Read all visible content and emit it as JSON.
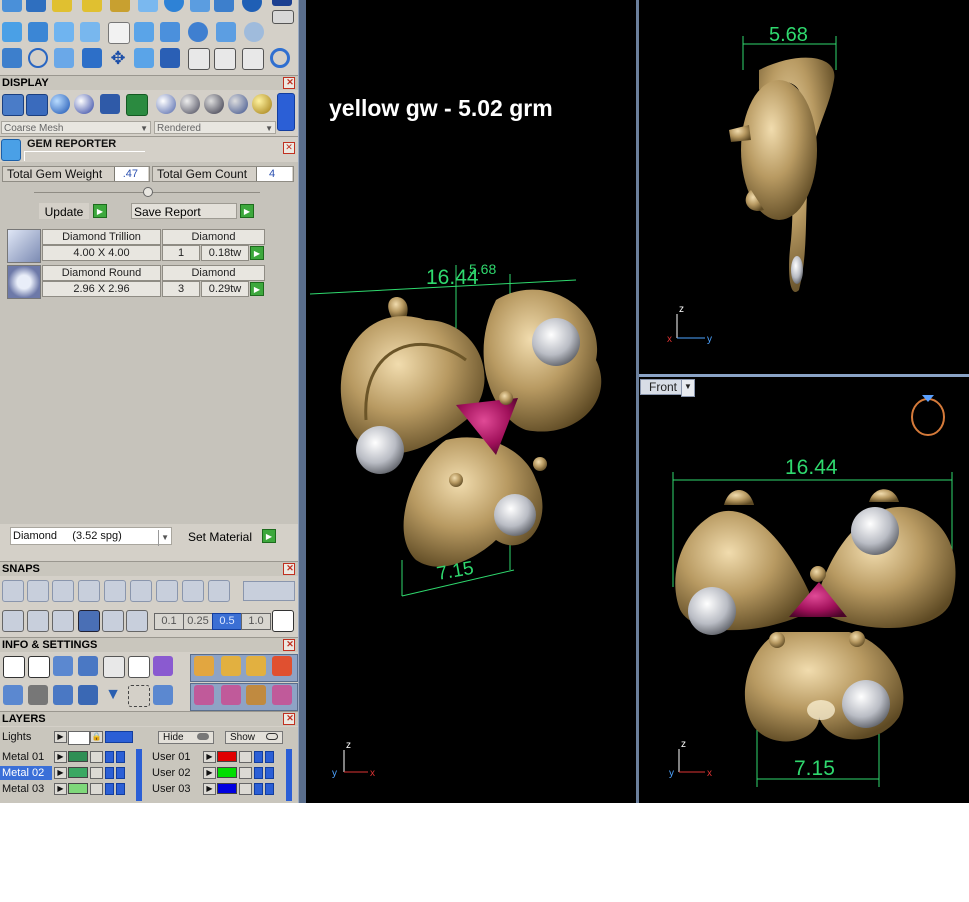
{
  "display": {
    "title": "DISPLAY",
    "mesh_mode": "Coarse Mesh",
    "render_mode": "Rendered"
  },
  "gem_reporter": {
    "title": "GEM REPORTER",
    "total_weight_label": "Total Gem Weight",
    "total_weight_value": ".47",
    "total_count_label": "Total Gem Count",
    "total_count_value": "4",
    "update_label": "Update",
    "save_report_label": "Save Report",
    "gems": [
      {
        "name": "Diamond Trillion",
        "material": "Diamond",
        "size": "4.00 X 4.00",
        "count": "1",
        "weight": "0.18tw"
      },
      {
        "name": "Diamond Round",
        "material": "Diamond",
        "size": "2.96 X 2.96",
        "count": "3",
        "weight": "0.29tw"
      }
    ],
    "material_select": "Diamond     (3.52 spg)",
    "set_material_label": "Set Material"
  },
  "snaps": {
    "title": "SNAPS",
    "grid_values": [
      "0.1",
      "0.25",
      "0.5",
      "1.0"
    ]
  },
  "info_settings": {
    "title": "INFO & SETTINGS"
  },
  "layers": {
    "title": "LAYERS",
    "lights_label": "Lights",
    "hide_label": "Hide",
    "show_label": "Show",
    "left_items": [
      "Metal 01",
      "Metal 02",
      "Metal 03"
    ],
    "right_items": [
      "User 01",
      "User 02",
      "User 03"
    ],
    "colors": {
      "metal_01": "#2f8f55",
      "metal_02": "#3aa862",
      "metal_03": "#7fd87a",
      "user_01": "#e00000",
      "user_02": "#00dd00",
      "user_03": "#0000e0"
    }
  },
  "viewport_perspective": {
    "annotation": "yellow gw - 5.02 grm",
    "dim_width": "16.44",
    "dim_depth": "5.68",
    "dim_bottom": "7.15"
  },
  "viewport_side": {
    "dim_top": "5.68"
  },
  "viewport_front": {
    "view_label": "Front",
    "dim_width": "16.44",
    "dim_bottom": "7.15"
  },
  "colors": {
    "gold": "#b89a62",
    "ruby": "#a0105a",
    "dimension": "#2fd96e",
    "panel_bg": "#d4d0c8"
  }
}
